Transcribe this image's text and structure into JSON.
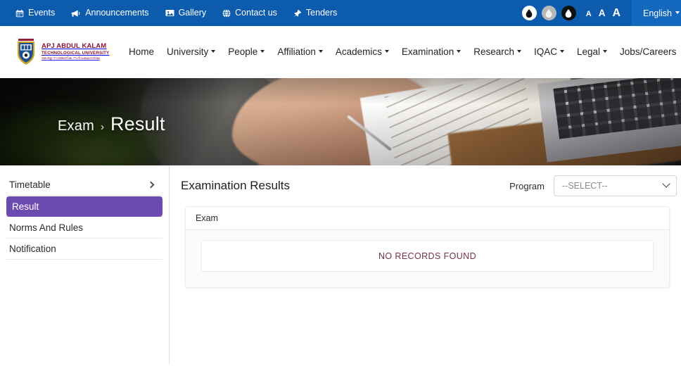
{
  "topbar": {
    "links": [
      {
        "label": "Events",
        "icon": "calendar-icon"
      },
      {
        "label": "Announcements",
        "icon": "megaphone-icon"
      },
      {
        "label": "Gallery",
        "icon": "image-icon"
      },
      {
        "label": "Contact us",
        "icon": "globe-icon"
      },
      {
        "label": "Tenders",
        "icon": "pin-icon"
      }
    ],
    "contrast": [
      {
        "name": "contrast-light",
        "color": "#ffffff"
      },
      {
        "name": "contrast-medium",
        "color": "#b7b7b7"
      },
      {
        "name": "contrast-dark",
        "color": "#101010"
      }
    ],
    "font_sizes": [
      "A",
      "A",
      "A"
    ],
    "language": "English",
    "accent_blue": "#0d5bad",
    "language_panel_blue": "#1468be"
  },
  "brand": {
    "line1": "APJ ABDUL KALAM",
    "line2": "TECHNOLOGICAL UNIVERSITY",
    "line3": "കേരള സാങ്കേതിക സർവകലാശാല",
    "color": "#8a1436"
  },
  "nav": {
    "items": [
      {
        "label": "Home",
        "has_dropdown": false
      },
      {
        "label": "University",
        "has_dropdown": true
      },
      {
        "label": "People",
        "has_dropdown": true
      },
      {
        "label": "Affiliation",
        "has_dropdown": true
      },
      {
        "label": "Academics",
        "has_dropdown": true
      },
      {
        "label": "Examination",
        "has_dropdown": true
      },
      {
        "label": "Research",
        "has_dropdown": true
      },
      {
        "label": "IQAC",
        "has_dropdown": true
      },
      {
        "label": "Legal",
        "has_dropdown": true
      },
      {
        "label": "Jobs/Careers",
        "has_dropdown": false
      }
    ]
  },
  "hero": {
    "breadcrumb_parent": "Exam",
    "breadcrumb_separator": "›",
    "breadcrumb_current": "Result"
  },
  "sidebar": {
    "items": [
      {
        "label": "Timetable",
        "active": false,
        "chevron": true
      },
      {
        "label": "Result",
        "active": true,
        "chevron": false
      },
      {
        "label": "Norms And Rules",
        "active": false,
        "chevron": false
      },
      {
        "label": "Notification",
        "active": false,
        "chevron": false
      }
    ],
    "active_color": "#6d4aaf"
  },
  "main": {
    "title": "Examination Results",
    "program_label": "Program",
    "program_value": "--SELECT--",
    "program_options": [
      "--SELECT--"
    ],
    "panel_header": "Exam",
    "empty_message": "NO RECORDS FOUND",
    "empty_message_color": "#74304c"
  }
}
